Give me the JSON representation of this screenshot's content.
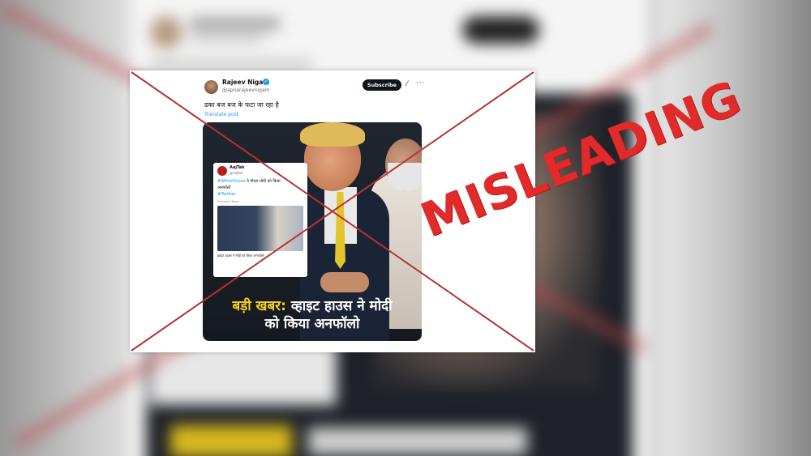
{
  "tweet": {
    "author_name": "Rajeev Nigam",
    "author_handle": "@apnarajeevnigam",
    "subscribe_label": "Subscribe",
    "text": "ढका बज बज के फटा जा रहा है",
    "translate_label": "Translate post"
  },
  "inset_tweet": {
    "name": "AajTak",
    "handle": "@aajtak",
    "hashtag_whitehouse": "#WhiteHouse",
    "text_line1": "ने पीएम मोदी को किया",
    "text_line2": "अनफॉलो",
    "hashtag_twitter": "#Twitter",
    "translate_label": "Translate Tweet",
    "caption": "व्हाइट हाउस ने मोदी को किया अनफॉलो"
  },
  "headline": {
    "highlight": "बड़ी खबर:",
    "rest_line1": "व्हाइट हाउस ने मोदी",
    "line2": "को किया अनफॉलो"
  },
  "verdict_stamp": "MISLEADING",
  "colors": {
    "stamp": "#e12a2a",
    "cross": "#b83232",
    "highlight": "#f5cf1d",
    "link": "#1d9bf0"
  }
}
